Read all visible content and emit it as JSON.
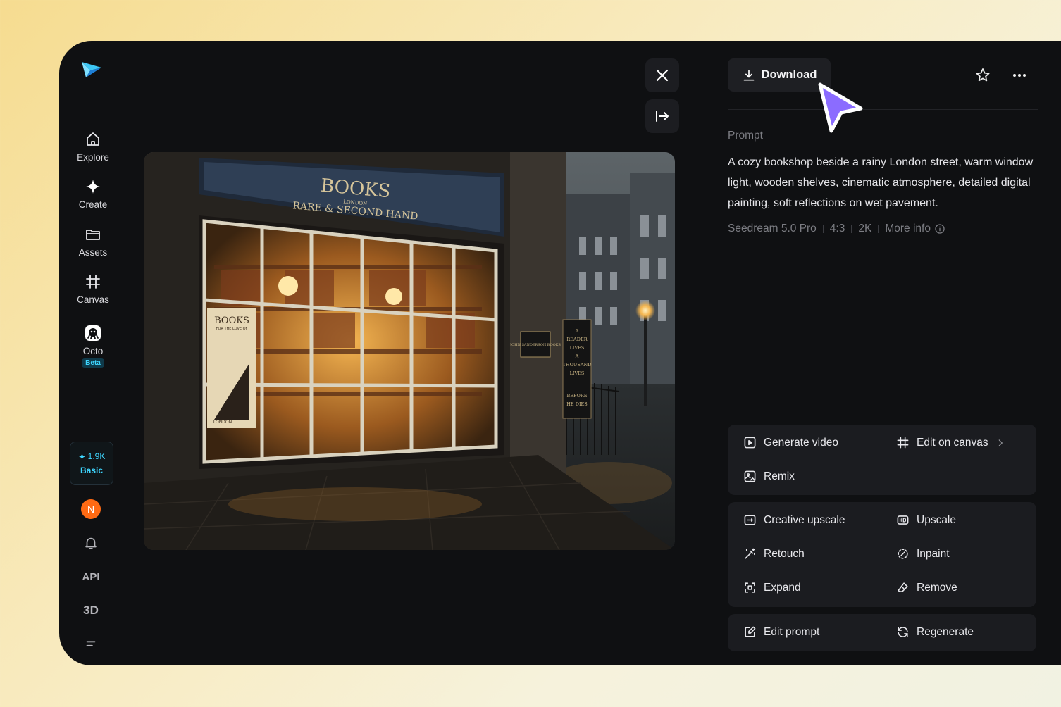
{
  "sidebar": {
    "items": [
      {
        "label": "Explore",
        "icon": "home-icon"
      },
      {
        "label": "Create",
        "icon": "sparkle-icon"
      },
      {
        "label": "Assets",
        "icon": "folder-icon"
      },
      {
        "label": "Canvas",
        "icon": "canvas-icon"
      },
      {
        "label": "Octo",
        "icon": "octo-icon",
        "badge": "Beta"
      }
    ],
    "credits": {
      "amount": "1.9K",
      "plan": "Basic"
    },
    "avatar_initial": "N",
    "api_label": "API",
    "three_d_label": "3D"
  },
  "toolbar": {
    "download_label": "Download"
  },
  "prompt": {
    "label": "Prompt",
    "text": "A cozy bookshop beside a rainy London street, warm window light, wooden shelves, cinematic atmosphere, detailed digital painting, soft reflections on wet pavement.",
    "model": "Seedream 5.0 Pro",
    "ratio": "4:3",
    "resolution": "2K",
    "more_info": "More info"
  },
  "artwork": {
    "sign_main": "BOOKS",
    "sign_sub": "RARE & SECOND HAND",
    "sign_city": "LONDON",
    "poster_title": "BOOKS",
    "poster_sub": "FOR THE LOVE OF",
    "poster_city": "LONDON",
    "plaque": "JOHN SANDERSON BOOKS",
    "board_text": [
      "A",
      "READER",
      "LIVES",
      "A",
      "THOUSAND",
      "LIVES",
      "BEFORE",
      "HE DIES"
    ]
  },
  "actions": {
    "generate_video": "Generate video",
    "edit_on_canvas": "Edit on canvas",
    "remix": "Remix",
    "creative_upscale": "Creative upscale",
    "upscale": "Upscale",
    "retouch": "Retouch",
    "inpaint": "Inpaint",
    "expand": "Expand",
    "remove": "Remove",
    "edit_prompt": "Edit prompt",
    "regenerate": "Regenerate"
  },
  "colors": {
    "accent": "#3ed6ff",
    "cursor": "#8b6cff",
    "avatar": "#ff6a13",
    "panel": "#0f1012",
    "card": "#1b1c20"
  }
}
